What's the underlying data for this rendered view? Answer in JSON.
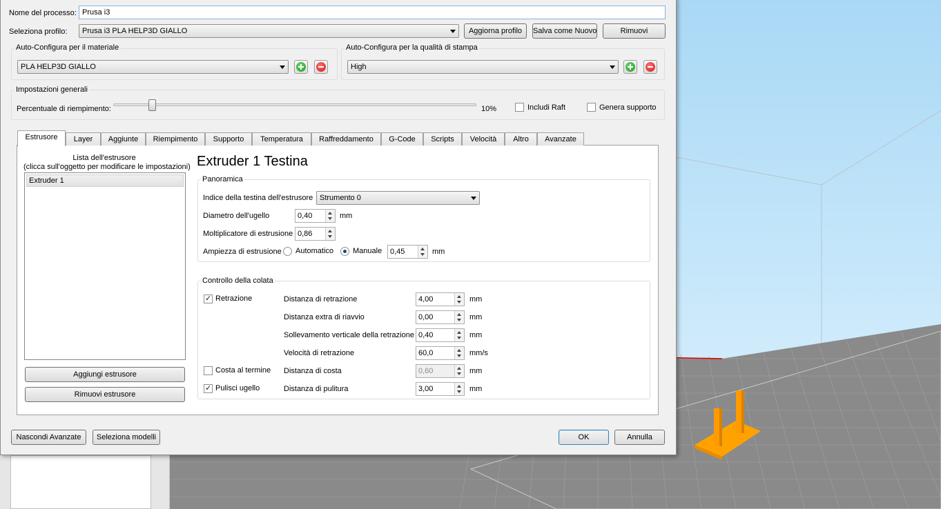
{
  "process": {
    "name_label": "Nome del processo:",
    "name_value": "Prusa i3",
    "profile_label": "Seleziona profilo:",
    "profile_value": "Prusa i3 PLA HELP3D GIALLO",
    "update_profile": "Aggiorna profilo",
    "save_as_new": "Salva come Nuovo",
    "remove": "Rimuovi"
  },
  "material": {
    "title": "Auto-Configura per il materiale",
    "value": "PLA HELP3D GIALLO"
  },
  "quality": {
    "title": "Auto-Configura per la qualità di stampa",
    "value": "High"
  },
  "general": {
    "title": "Impostazioni generali",
    "infill_label": "Percentuale di riempimento:",
    "infill_value": "10%",
    "infill_fraction": 0.1,
    "raft_label": "Includi Raft",
    "raft_checked": false,
    "support_label": "Genera supporto",
    "support_checked": false
  },
  "tabs": [
    {
      "label": "Estrusore",
      "active": true
    },
    {
      "label": "Layer"
    },
    {
      "label": "Aggiunte"
    },
    {
      "label": "Riempimento"
    },
    {
      "label": "Supporto"
    },
    {
      "label": "Temperatura"
    },
    {
      "label": "Raffreddamento"
    },
    {
      "label": "G-Code"
    },
    {
      "label": "Scripts"
    },
    {
      "label": "Velocità"
    },
    {
      "label": "Altro"
    },
    {
      "label": "Avanzate"
    }
  ],
  "extruder_list": {
    "title_line1": "Lista dell'estrusore",
    "title_line2": "(clicca sull'oggetto per modificare le impostazioni)",
    "items": [
      "Extruder 1"
    ],
    "add_button": "Aggiungi estrusore",
    "remove_button": "Rimuovi estrusore"
  },
  "extruder": {
    "heading": "Extruder 1 Testina",
    "overview": {
      "title": "Panoramica",
      "head_index_label": "Indice della testina dell'estrusore",
      "head_index_value": "Strumento 0",
      "nozzle_label": "Diametro dell'ugello",
      "nozzle_value": "0,40",
      "nozzle_unit": "mm",
      "multiplier_label": "Moltiplicatore di estrusione",
      "multiplier_value": "0,86",
      "width_label": "Ampiezza di estrusione",
      "width_auto": "Automatico",
      "width_manual": "Manuale",
      "width_value": "0,45",
      "width_unit": "mm"
    },
    "ooze": {
      "title": "Controllo della colata",
      "retraction_label": "Retrazione",
      "retraction_checked": true,
      "retract_dist_label": "Distanza di retrazione",
      "retract_dist_value": "4,00",
      "extra_restart_label": "Distanza extra di riavvio",
      "extra_restart_value": "0,00",
      "vertical_lift_label": "Sollevamento verticale della retrazione",
      "vertical_lift_value": "0,40",
      "retract_speed_label": "Velocità di retrazione",
      "retract_speed_value": "60,0",
      "coast_label": "Costa al termine",
      "coast_checked": false,
      "coast_dist_label": "Distanza di costa",
      "coast_dist_value": "0,60",
      "wipe_label": "Pulisci ugello",
      "wipe_checked": true,
      "wipe_dist_label": "Distanza di pulitura",
      "wipe_dist_value": "3,00",
      "unit_mm": "mm",
      "unit_mms": "mm/s"
    }
  },
  "footer": {
    "hide_advanced": "Nascondi Avanzate",
    "select_models": "Seleziona modelli",
    "ok": "OK",
    "cancel": "Annulla"
  },
  "colors": {
    "sky_top": "#a9d8f5",
    "bed": "#8c8c8c",
    "model": "#ffa200"
  }
}
